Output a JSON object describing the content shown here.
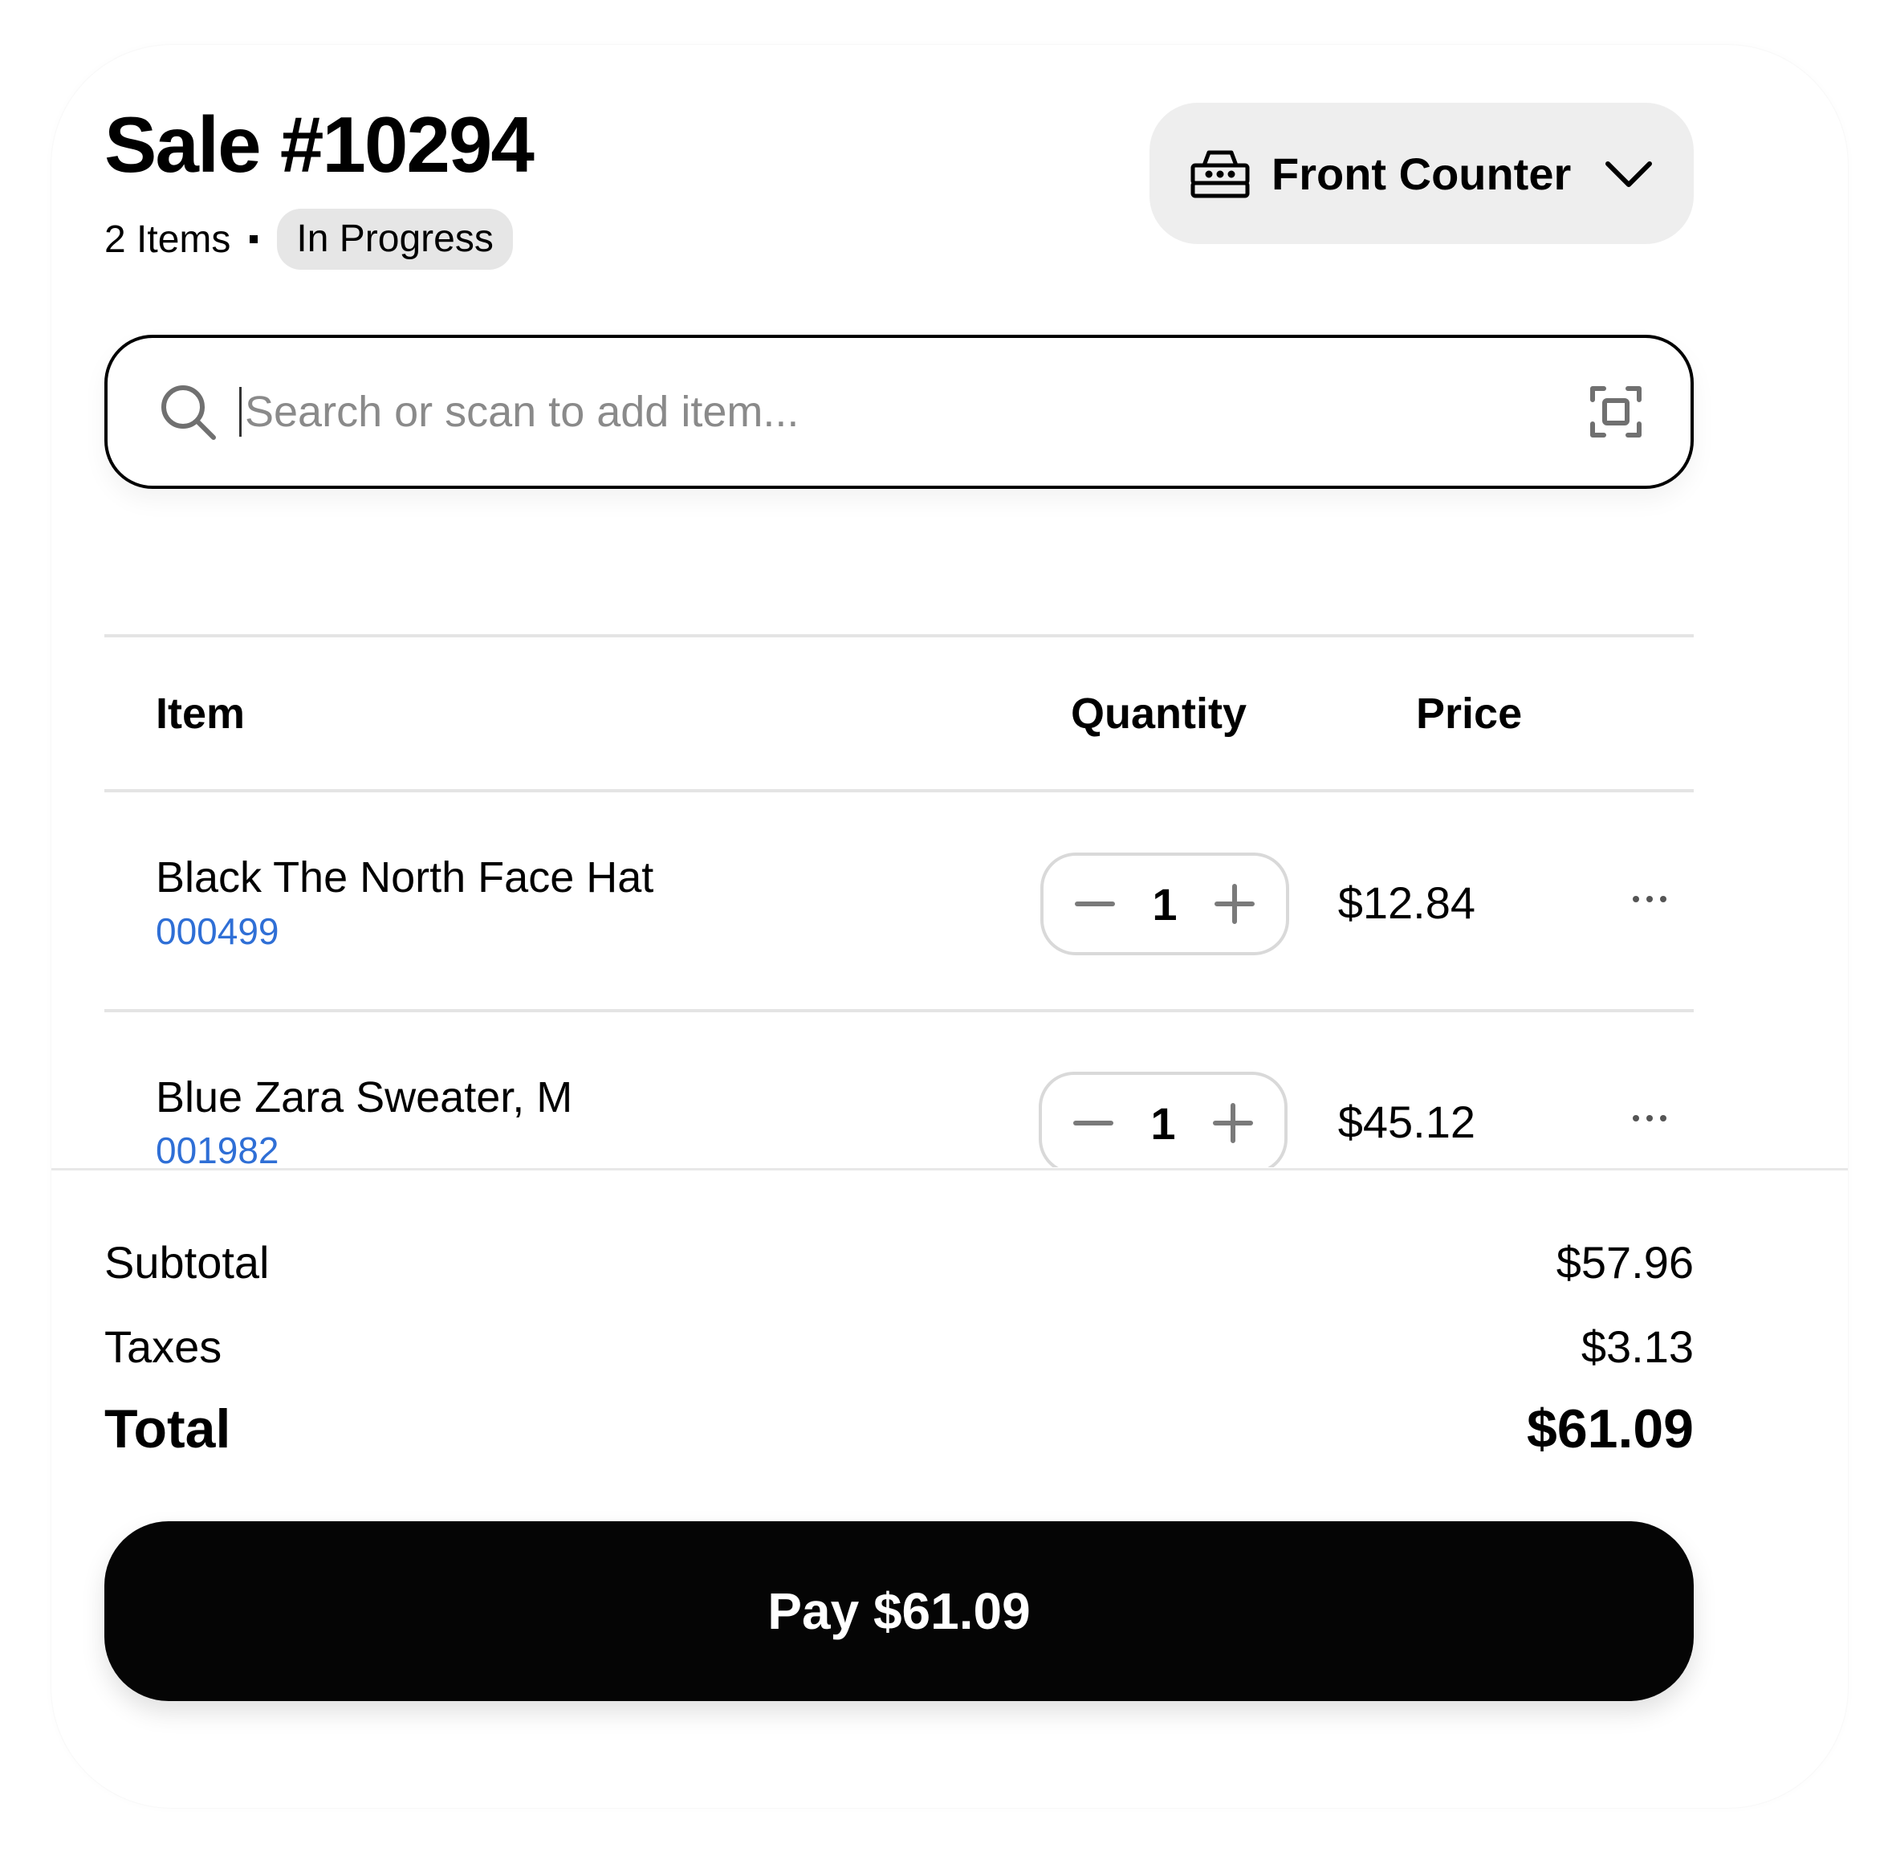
{
  "header": {
    "title": "Sale #10294",
    "item_count": "2 Items",
    "status": "In Progress"
  },
  "register": {
    "label": "Front Counter",
    "icon": "cash-register-icon"
  },
  "search": {
    "placeholder": "Search or scan to add item...",
    "value": "",
    "icon": "search-icon",
    "scan_icon": "scan-icon"
  },
  "table": {
    "columns": [
      "Item",
      "Quantity",
      "Price"
    ],
    "rows": [
      {
        "name": "Black The North Face Hat",
        "sku": "000499",
        "quantity": "1",
        "price": "$12.84"
      },
      {
        "name": "Blue Zara Sweater, M",
        "sku": "001982",
        "quantity": "1",
        "price": "$45.12"
      }
    ]
  },
  "totals": {
    "subtotal_label": "Subtotal",
    "subtotal": "$57.96",
    "taxes_label": "Taxes",
    "taxes": "$3.13",
    "total_label": "Total",
    "total": "$61.09"
  },
  "pay_button": {
    "label": "Pay $61.09"
  },
  "colors": {
    "accent_sku": "#2f6fd6",
    "badge_bg": "#e6e6e6",
    "button_bg": "#050505"
  }
}
